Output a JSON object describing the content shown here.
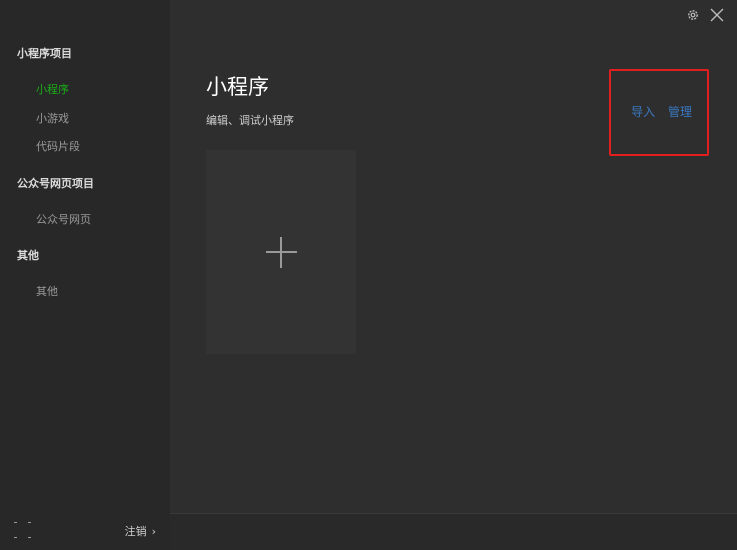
{
  "sidebar": {
    "groups": [
      {
        "title": "小程序项目",
        "items": [
          {
            "label": "小程序"
          },
          {
            "label": "小游戏"
          },
          {
            "label": "代码片段"
          }
        ]
      },
      {
        "title": "公众号网页项目",
        "items": [
          {
            "label": "公众号网页"
          }
        ]
      },
      {
        "title": "其他",
        "items": [
          {
            "label": "其他"
          }
        ]
      }
    ],
    "active_item": "小程序",
    "footer": {
      "logout_label": "注销",
      "chevron": "›"
    }
  },
  "header": {
    "icons": [
      "gear-icon",
      "close-icon"
    ]
  },
  "main": {
    "title": "小程序",
    "subtitle": "编辑、调试小程序",
    "actions": [
      {
        "label": "导入"
      },
      {
        "label": "管理"
      }
    ],
    "add_card_icon": "plus-icon"
  },
  "colors": {
    "active": "#1aad19",
    "link": "#3a78c0",
    "highlight": "#e02020",
    "background": "#2e2e2e",
    "sidebar": "#282828"
  }
}
